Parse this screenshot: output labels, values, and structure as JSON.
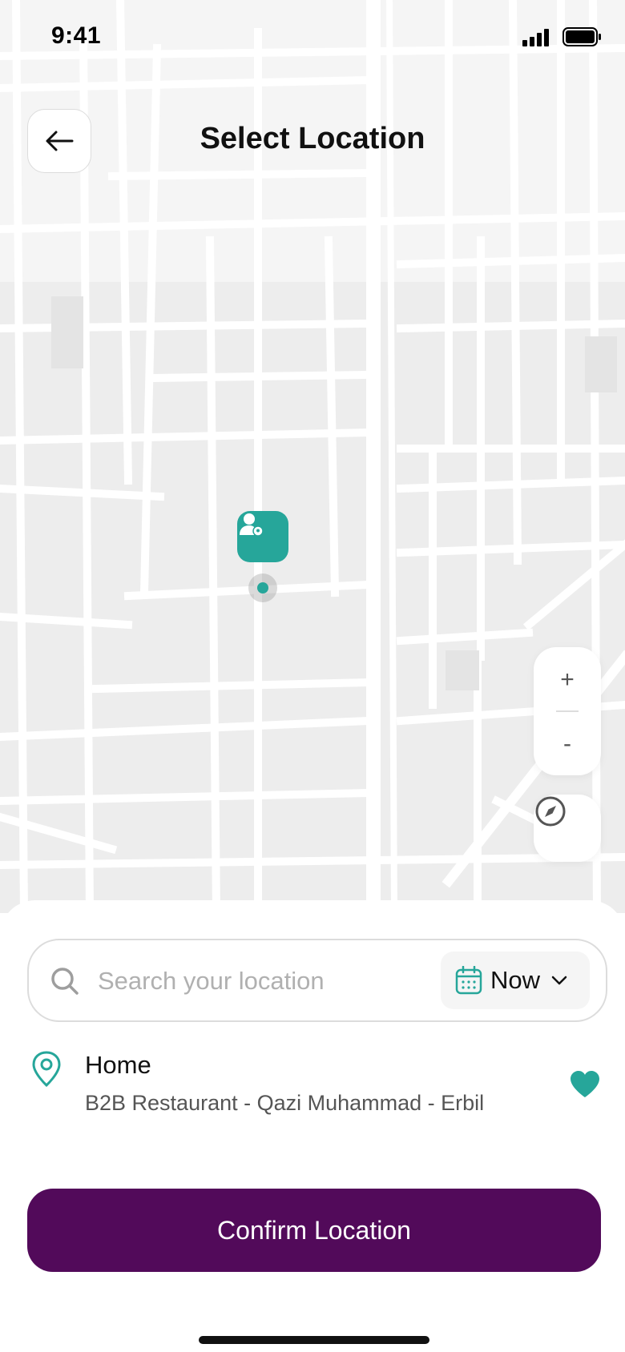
{
  "status_bar": {
    "time": "9:41",
    "icons": [
      "signal-icon",
      "battery-icon"
    ]
  },
  "header": {
    "title": "Select Location",
    "back_icon": "arrow-left-icon"
  },
  "map": {
    "marker_icon": "user-location-icon",
    "accent_color": "#26a69a",
    "zoom_in_label": "+",
    "zoom_out_label": "-",
    "compass_icon": "compass-icon"
  },
  "search": {
    "placeholder": "Search your location",
    "value": "",
    "icon": "search-icon"
  },
  "time_select": {
    "selected": "Now",
    "icon": "calendar-icon"
  },
  "saved_location": {
    "name": "Home",
    "address": "B2B Restaurant - Qazi Muhammad - Erbil",
    "icon": "map-pin-icon",
    "favorite_icon": "heart-icon",
    "favorite": true
  },
  "confirm_button": {
    "label": "Confirm Location",
    "color": "#520a5a"
  }
}
